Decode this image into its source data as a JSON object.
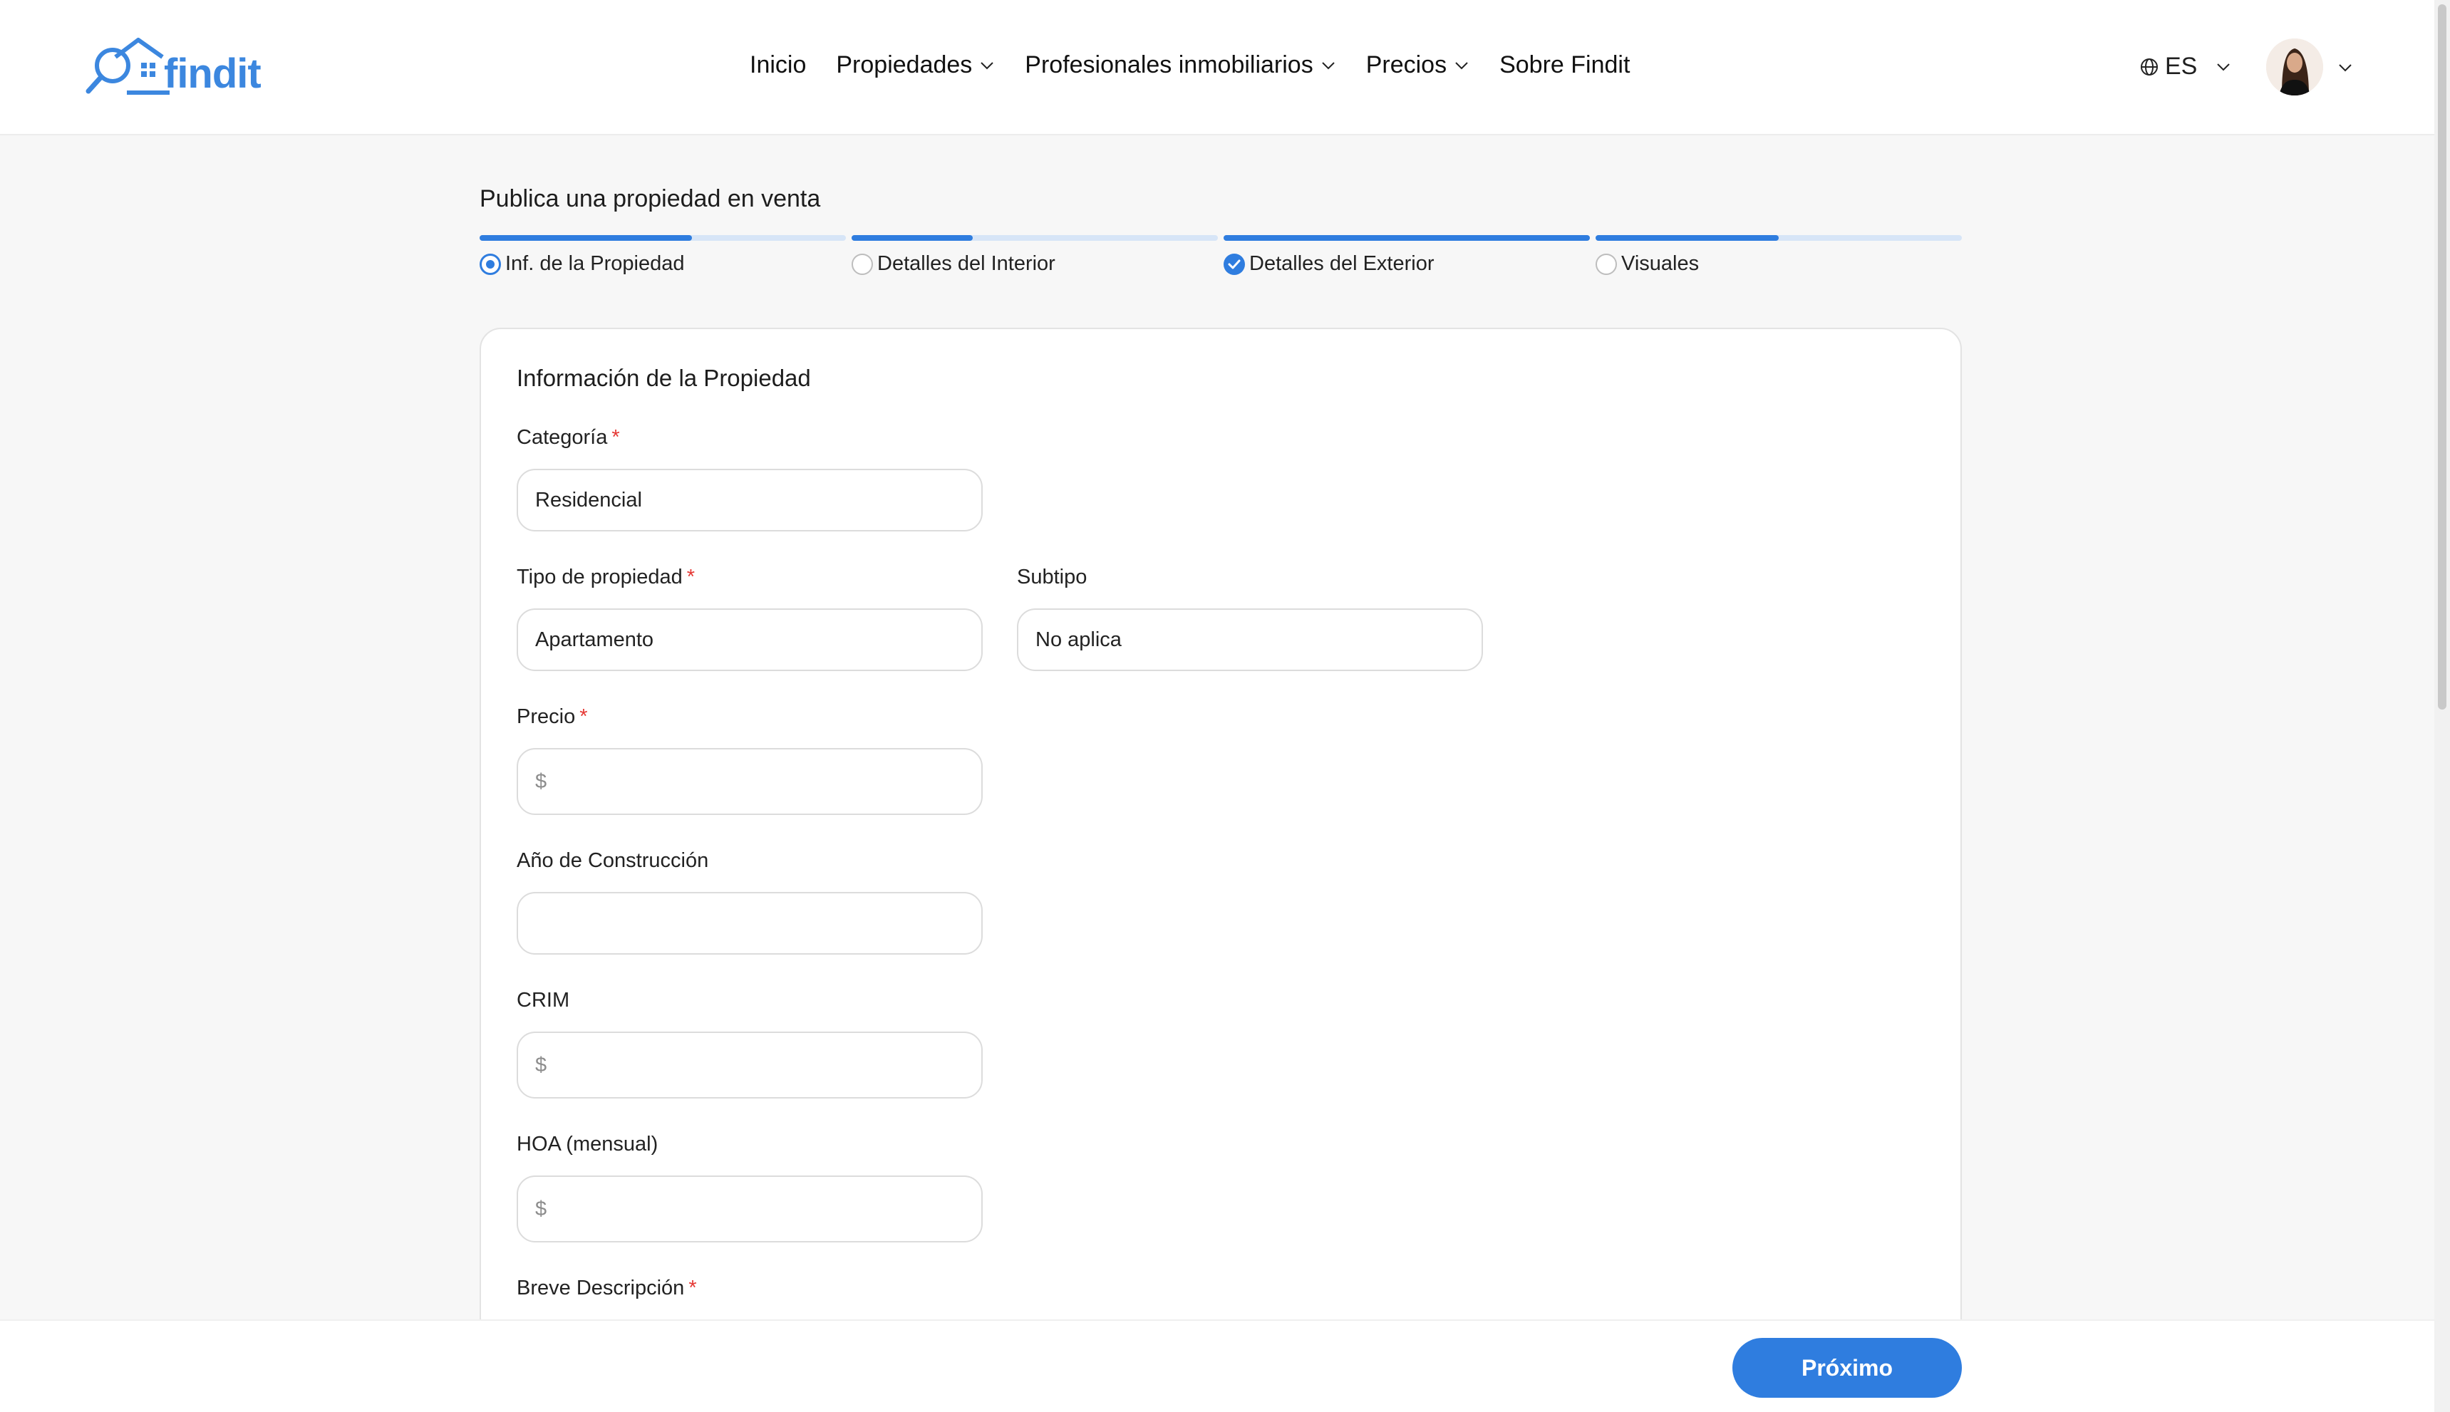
{
  "header": {
    "logo_text": "findit",
    "nav": [
      {
        "label": "Inicio"
      },
      {
        "label": "Propiedades"
      },
      {
        "label": "Profesionales inmobiliarios"
      },
      {
        "label": "Precios"
      },
      {
        "label": "Sobre Findit"
      }
    ],
    "language": "ES"
  },
  "page": {
    "title": "Publica una propiedad en venta",
    "steps": [
      {
        "label": "Inf. de la Propiedad",
        "state": "active",
        "progress": 0.58
      },
      {
        "label": "Detalles del Interior",
        "state": "empty",
        "progress": 0.33
      },
      {
        "label": "Detalles del Exterior",
        "state": "done",
        "progress": 1.0
      },
      {
        "label": "Visuales",
        "state": "empty",
        "progress": 0.5
      }
    ]
  },
  "form": {
    "section_title": "Información de la Propiedad",
    "categoria": {
      "label": "Categoría",
      "required_mark": "*",
      "value": "Residencial"
    },
    "tipo": {
      "label": "Tipo de propiedad",
      "required_mark": "*",
      "value": "Apartamento"
    },
    "subtipo": {
      "label": "Subtipo",
      "value": "No aplica"
    },
    "precio": {
      "label": "Precio",
      "required_mark": "*",
      "prefix": "$",
      "value": ""
    },
    "anio": {
      "label": "Año de Construcción",
      "value": ""
    },
    "crim": {
      "label": "CRIM",
      "prefix": "$",
      "value": ""
    },
    "hoa": {
      "label": "HOA (mensual)",
      "prefix": "$",
      "value": ""
    },
    "descripcion": {
      "label": "Breve Descripción",
      "required_mark": "*"
    }
  },
  "footer": {
    "next_label": "Próximo"
  },
  "colors": {
    "accent": "#2f7ddf",
    "track": "#d7e5f7",
    "required": "#e53935"
  }
}
